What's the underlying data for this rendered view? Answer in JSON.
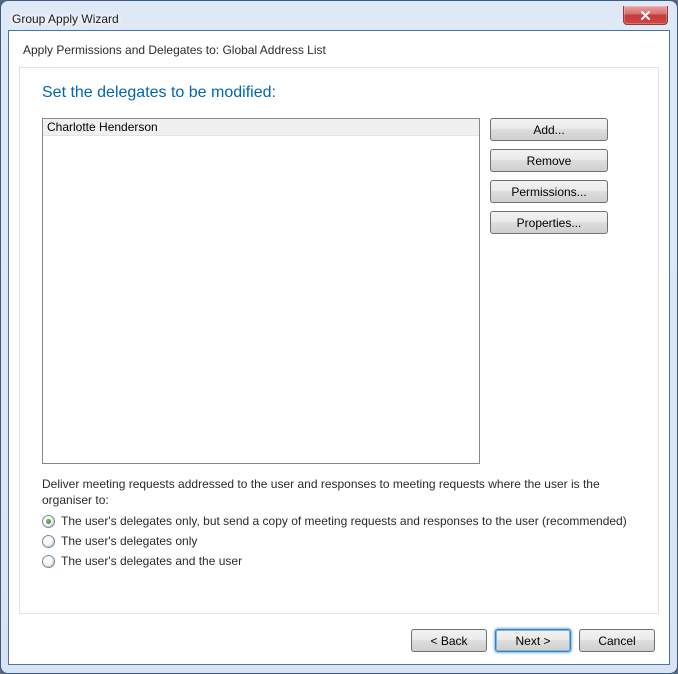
{
  "window": {
    "title": "Group Apply Wizard"
  },
  "subtitle_prefix": "Apply Permissions and Delegates to: ",
  "subtitle_target": "Global Address List",
  "heading": "Set the delegates to be modified:",
  "delegates": [
    "Charlotte Henderson"
  ],
  "buttons": {
    "add": "Add...",
    "remove": "Remove",
    "permissions": "Permissions...",
    "properties": "Properties..."
  },
  "radio": {
    "intro": "Deliver meeting requests addressed to the user and responses to meeting requests where the user is the organiser to:",
    "options": [
      {
        "label": "The user's delegates only, but send a copy of meeting requests and responses to the user (recommended)",
        "checked": true
      },
      {
        "label": "The user's delegates only",
        "checked": false
      },
      {
        "label": "The user's delegates and the user",
        "checked": false
      }
    ]
  },
  "footer": {
    "back": "< Back",
    "next": "Next >",
    "cancel": "Cancel"
  }
}
